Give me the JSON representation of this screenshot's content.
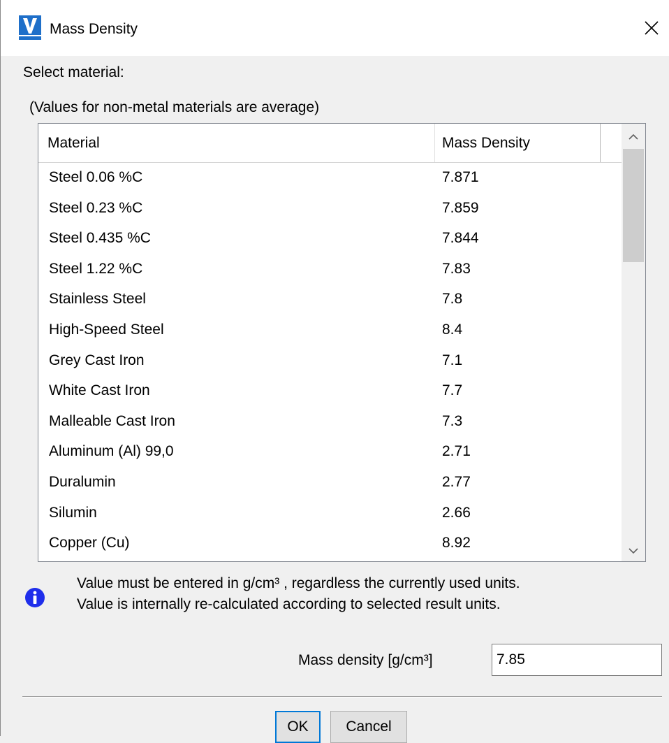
{
  "window": {
    "title": "Mass Density",
    "icon": "vericad-app-icon",
    "close_icon": "close-icon"
  },
  "labels": {
    "select_material": "Select material:",
    "note": "(Values for non-metal materials are average)"
  },
  "table": {
    "columns": [
      "Material",
      "Mass Density"
    ],
    "rows": [
      {
        "material": "Steel 0.06 %C",
        "density": "7.871"
      },
      {
        "material": "Steel 0.23 %C",
        "density": "7.859"
      },
      {
        "material": "Steel 0.435 %C",
        "density": "7.844"
      },
      {
        "material": "Steel 1.22 %C",
        "density": "7.83"
      },
      {
        "material": "Stainless Steel",
        "density": "7.8"
      },
      {
        "material": "High-Speed Steel",
        "density": "8.4"
      },
      {
        "material": "Grey Cast Iron",
        "density": "7.1"
      },
      {
        "material": "White Cast Iron",
        "density": "7.7"
      },
      {
        "material": "Malleable Cast Iron",
        "density": "7.3"
      },
      {
        "material": "Aluminum (Al) 99,0",
        "density": "2.71"
      },
      {
        "material": "Duralumin",
        "density": "2.77"
      },
      {
        "material": "Silumin",
        "density": "2.66"
      },
      {
        "material": "Copper (Cu)",
        "density": "8.92"
      }
    ]
  },
  "info": {
    "line1": "Value must be entered in g/cm³ , regardless the currently used units.",
    "line2": "Value is internally re-calculated according to selected result units."
  },
  "field": {
    "label": "Mass density  [g/cm³]",
    "value": "7.85"
  },
  "buttons": {
    "ok": "OK",
    "cancel": "Cancel"
  },
  "colors": {
    "accent": "#0078d7",
    "info_icon": "#1f2eeb"
  }
}
